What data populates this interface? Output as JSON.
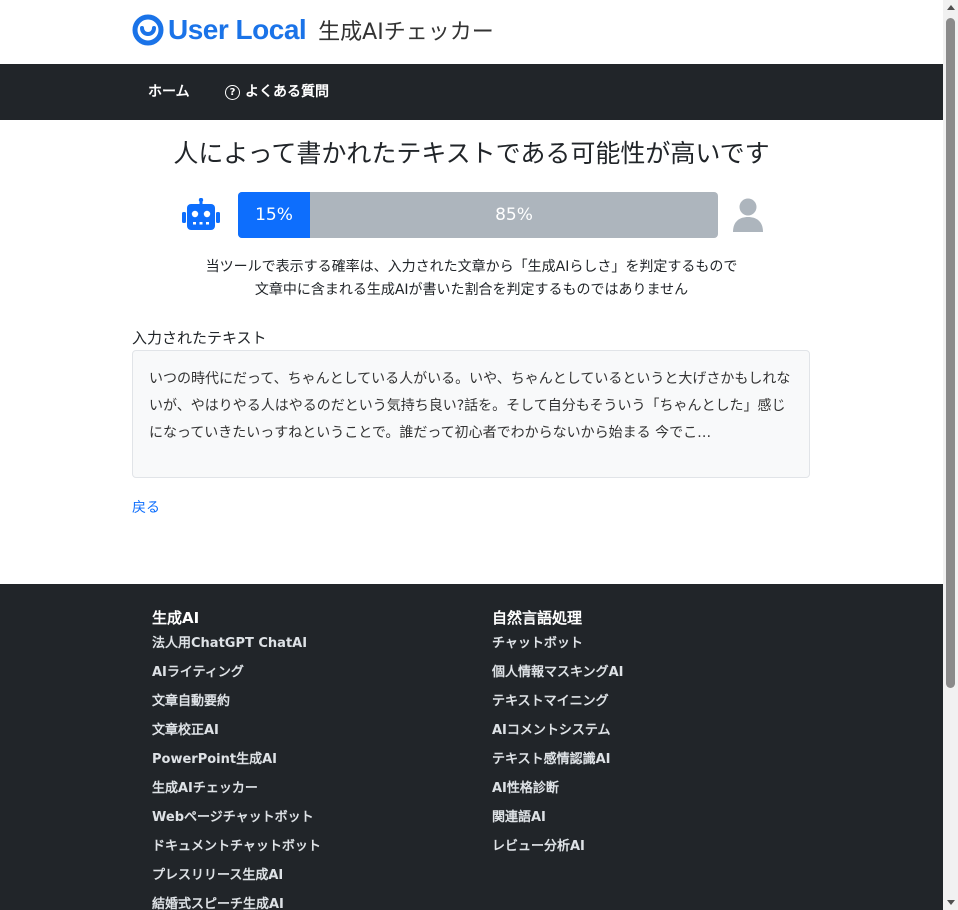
{
  "header": {
    "logo_text": "User Local",
    "product_name": "生成AIチェッカー",
    "brand_color": "#1a73e8"
  },
  "nav": {
    "home": "ホーム",
    "faq": "よくある質問"
  },
  "result": {
    "title": "人によって書かれたテキストである可能性が高いです",
    "ai_percent": 15,
    "ai_label": "15%",
    "human_percent": 85,
    "human_label": "85%",
    "disclaimer_line1": "当ツールで表示する確率は、入力された文章から「生成AIらしさ」を判定するもので",
    "disclaimer_line2": "文章中に含まれる生成AIが書いた割合を判定するものではありません",
    "ai_color": "#0d6efd",
    "human_color": "#adb5bd"
  },
  "input": {
    "label": "入力されたテキスト",
    "text": "いつの時代にだって、ちゃんとしている人がいる。いや、ちゃんとしているというと大げさかもしれないが、やはりやる人はやるのだという気持ち良い?話を。そして自分もそういう「ちゃんとした」感じになっていきたいっすねということで。誰だって初心者でわからないから始まる 今でこ…"
  },
  "back_link": "戻る",
  "footer": {
    "col1": {
      "heading": "生成AI",
      "links": [
        "法人用ChatGPT ChatAI",
        "AIライティング",
        "文章自動要約",
        "文章校正AI",
        "PowerPoint生成AI",
        "生成AIチェッカー",
        "Webページチャットボット",
        "ドキュメントチャットボット",
        "プレスリリース生成AI",
        "結婚式スピーチ生成AI"
      ]
    },
    "col2": {
      "heading": "自然言語処理",
      "links": [
        "チャットボット",
        "個人情報マスキングAI",
        "テキストマイニング",
        "AIコメントシステム",
        "テキスト感情認識AI",
        "AI性格診断",
        "関連語AI",
        "レビュー分析AI"
      ]
    }
  }
}
